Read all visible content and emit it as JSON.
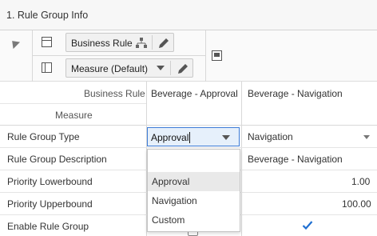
{
  "section": {
    "title": "1. Rule Group Info"
  },
  "toolbar": {
    "dims": [
      {
        "label": "Business Rule"
      },
      {
        "label": "Measure (Default)"
      }
    ]
  },
  "grid": {
    "col_header_row1_label": "Business Rule",
    "col_header_row2_label": "Measure",
    "columns": [
      "Beverage - Approval",
      "Beverage - Navigation"
    ],
    "rows": [
      {
        "label": "Rule Group Type",
        "values": [
          "Approval",
          "Navigation"
        ]
      },
      {
        "label": "Rule Group Description",
        "values": [
          "",
          "Beverage - Navigation"
        ]
      },
      {
        "label": "Priority Lowerbound",
        "values": [
          "",
          "1.00"
        ]
      },
      {
        "label": "Priority Upperbound",
        "values": [
          "",
          "100.00"
        ]
      },
      {
        "label": "Enable Rule Group",
        "values": [
          "",
          ""
        ]
      }
    ]
  },
  "editor": {
    "typed_value": "Approval",
    "options": [
      "Approval",
      "Navigation",
      "Custom"
    ],
    "highlighted_option": "Approval"
  },
  "colors": {
    "accent": "#3d7bd6",
    "check": "#1f6fd1"
  }
}
